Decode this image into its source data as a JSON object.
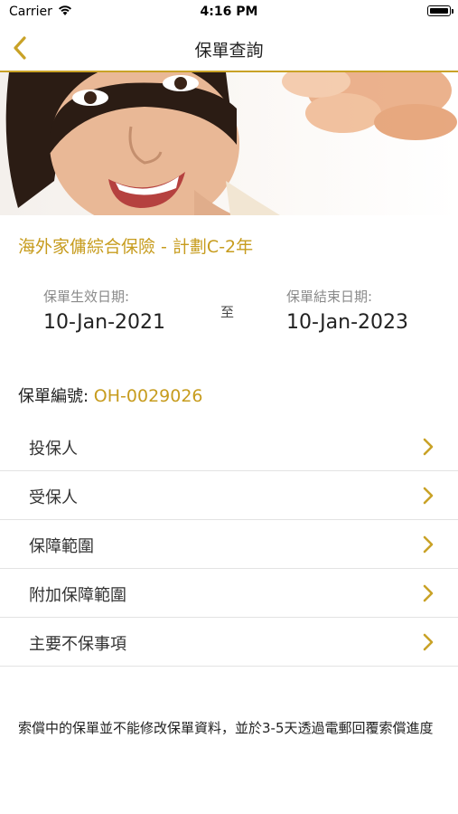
{
  "status_bar": {
    "carrier": "Carrier",
    "time": "4:16 PM"
  },
  "nav": {
    "title": "保單查詢",
    "back_icon": "chevron-left-icon",
    "accent_color": "#c9a227"
  },
  "plan": {
    "name": "海外家傭綜合保險 - 計劃C-2年",
    "start_label": "保單生效日期:",
    "start_date": "10-Jan-2021",
    "to_label": "至",
    "end_label": "保單結束日期:",
    "end_date": "10-Jan-2023",
    "policy_label": "保單編號: ",
    "policy_number": "OH-0029026"
  },
  "menu": {
    "items": [
      {
        "label": "投保人"
      },
      {
        "label": "受保人"
      },
      {
        "label": "保障範圍"
      },
      {
        "label": "附加保障範圍"
      },
      {
        "label": "主要不保事項"
      }
    ],
    "chevron_icon": "chevron-right-icon"
  },
  "note": "索償中的保單並不能修改保單資料，並於3-5天透過電郵回覆索償進度"
}
